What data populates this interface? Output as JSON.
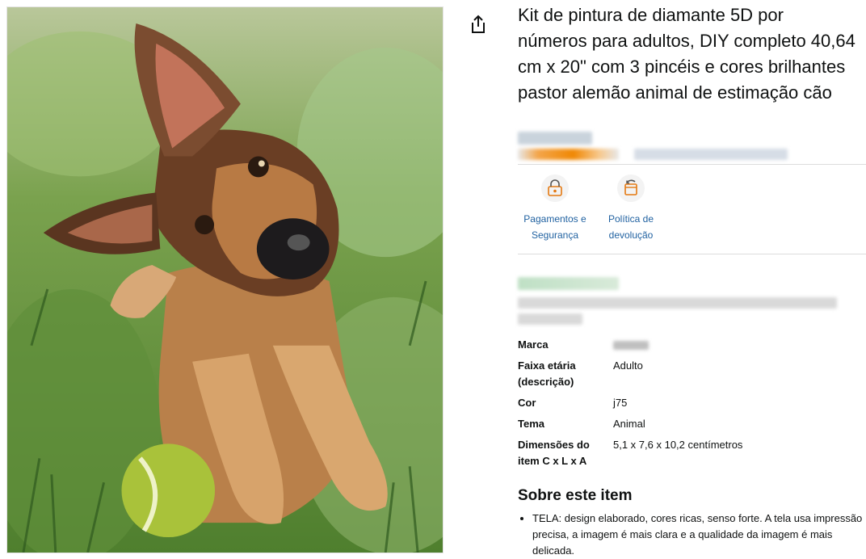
{
  "product": {
    "title": "Kit de pintura de diamante 5D por números para adultos, DIY completo 40,64 cm x 20\" com 3 pincéis e cores brilhantes pastor alemão animal de estimação cão",
    "image_subject": "german-shepherd-puppy-painting"
  },
  "features": [
    {
      "label": "Pagamentos e Segurança",
      "icon": "secure-payment-icon"
    },
    {
      "label": "Política de devolução",
      "icon": "return-policy-icon"
    }
  ],
  "specs": [
    {
      "key": "Marca",
      "value": ""
    },
    {
      "key": "Faixa etária (descrição)",
      "value": "Adulto"
    },
    {
      "key": "Cor",
      "value": "j75"
    },
    {
      "key": "Tema",
      "value": "Animal"
    },
    {
      "key": "Dimensões do item C x L x A",
      "value": "5,1 x 7,6 x 10,2 centímetros"
    }
  ],
  "about": {
    "heading": "Sobre este item",
    "bullets": [
      "TELA: design elaborado, cores ricas, senso forte. A tela usa impressão precisa, a imagem é mais clara e a qualidade da imagem é mais delicada."
    ]
  },
  "colors": {
    "link": "#2162A1",
    "rating_orange": "#F08804",
    "divider": "#DDDDDD"
  }
}
